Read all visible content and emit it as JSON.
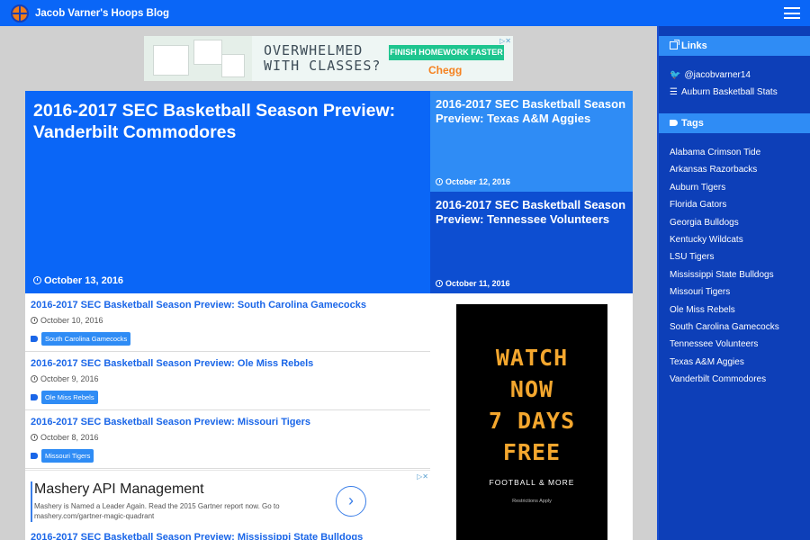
{
  "header": {
    "title": "Jacob Varner's Hoops Blog"
  },
  "ad_top": {
    "headline_line1": "OVERWHELMED",
    "headline_line2": "WITH CLASSES?",
    "cta": "FINISH HOMEWORK FASTER",
    "brand": "Chegg"
  },
  "hero": {
    "title": "2016-2017 SEC Basketball Season Preview: Vanderbilt Commodores",
    "date": "October 13, 2016"
  },
  "featured": [
    {
      "title": "2016-2017 SEC Basketball Season Preview: Texas A&M Aggies",
      "date": "October 12, 2016"
    },
    {
      "title": "2016-2017 SEC Basketball Season Preview: Tennessee Volunteers",
      "date": "October 11, 2016"
    }
  ],
  "posts": [
    {
      "title": "2016-2017 SEC Basketball Season Preview: South Carolina Gamecocks",
      "date": "October 10, 2016",
      "tag": "South Carolina Gamecocks"
    },
    {
      "title": "2016-2017 SEC Basketball Season Preview: Ole Miss Rebels",
      "date": "October 9, 2016",
      "tag": "Ole Miss Rebels"
    },
    {
      "title": "2016-2017 SEC Basketball Season Preview: Missouri Tigers",
      "date": "October 8, 2016",
      "tag": "Missouri Tigers"
    }
  ],
  "ad_mid": {
    "title": "Mashery API Management",
    "text": "Mashery is Named a Leader Again. Read the 2015 Gartner report now. Go to mashery.com/gartner-magic-quadrant"
  },
  "post_cut": {
    "title": "2016-2017 SEC Basketball Season Preview: Mississippi State Bulldogs"
  },
  "ad_side": {
    "line1": "WATCH",
    "line2": "NOW",
    "line3": "7 DAYS",
    "line4": "FREE",
    "sub": "FOOTBALL & MORE",
    "fine": "Restrictions Apply"
  },
  "sidebar": {
    "links_heading": "Links",
    "links": [
      "@jacobvarner14",
      "Auburn Basketball Stats"
    ],
    "tags_heading": "Tags",
    "tags": [
      "Alabama Crimson Tide",
      "Arkansas Razorbacks",
      "Auburn Tigers",
      "Florida Gators",
      "Georgia Bulldogs",
      "Kentucky Wildcats",
      "LSU Tigers",
      "Mississippi State Bulldogs",
      "Missouri Tigers",
      "Ole Miss Rebels",
      "South Carolina Gamecocks",
      "Tennessee Volunteers",
      "Texas A&M Aggies",
      "Vanderbilt Commodores"
    ]
  }
}
